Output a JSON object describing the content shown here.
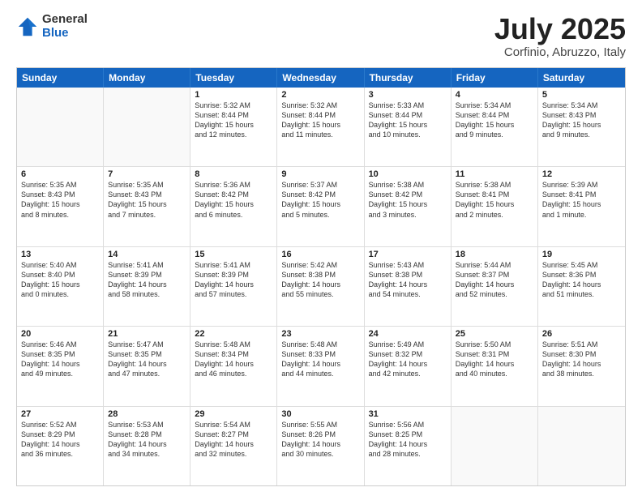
{
  "logo": {
    "general": "General",
    "blue": "Blue"
  },
  "title": "July 2025",
  "subtitle": "Corfinio, Abruzzo, Italy",
  "header_days": [
    "Sunday",
    "Monday",
    "Tuesday",
    "Wednesday",
    "Thursday",
    "Friday",
    "Saturday"
  ],
  "weeks": [
    [
      {
        "day": "",
        "lines": []
      },
      {
        "day": "",
        "lines": []
      },
      {
        "day": "1",
        "lines": [
          "Sunrise: 5:32 AM",
          "Sunset: 8:44 PM",
          "Daylight: 15 hours",
          "and 12 minutes."
        ]
      },
      {
        "day": "2",
        "lines": [
          "Sunrise: 5:32 AM",
          "Sunset: 8:44 PM",
          "Daylight: 15 hours",
          "and 11 minutes."
        ]
      },
      {
        "day": "3",
        "lines": [
          "Sunrise: 5:33 AM",
          "Sunset: 8:44 PM",
          "Daylight: 15 hours",
          "and 10 minutes."
        ]
      },
      {
        "day": "4",
        "lines": [
          "Sunrise: 5:34 AM",
          "Sunset: 8:44 PM",
          "Daylight: 15 hours",
          "and 9 minutes."
        ]
      },
      {
        "day": "5",
        "lines": [
          "Sunrise: 5:34 AM",
          "Sunset: 8:43 PM",
          "Daylight: 15 hours",
          "and 9 minutes."
        ]
      }
    ],
    [
      {
        "day": "6",
        "lines": [
          "Sunrise: 5:35 AM",
          "Sunset: 8:43 PM",
          "Daylight: 15 hours",
          "and 8 minutes."
        ]
      },
      {
        "day": "7",
        "lines": [
          "Sunrise: 5:35 AM",
          "Sunset: 8:43 PM",
          "Daylight: 15 hours",
          "and 7 minutes."
        ]
      },
      {
        "day": "8",
        "lines": [
          "Sunrise: 5:36 AM",
          "Sunset: 8:42 PM",
          "Daylight: 15 hours",
          "and 6 minutes."
        ]
      },
      {
        "day": "9",
        "lines": [
          "Sunrise: 5:37 AM",
          "Sunset: 8:42 PM",
          "Daylight: 15 hours",
          "and 5 minutes."
        ]
      },
      {
        "day": "10",
        "lines": [
          "Sunrise: 5:38 AM",
          "Sunset: 8:42 PM",
          "Daylight: 15 hours",
          "and 3 minutes."
        ]
      },
      {
        "day": "11",
        "lines": [
          "Sunrise: 5:38 AM",
          "Sunset: 8:41 PM",
          "Daylight: 15 hours",
          "and 2 minutes."
        ]
      },
      {
        "day": "12",
        "lines": [
          "Sunrise: 5:39 AM",
          "Sunset: 8:41 PM",
          "Daylight: 15 hours",
          "and 1 minute."
        ]
      }
    ],
    [
      {
        "day": "13",
        "lines": [
          "Sunrise: 5:40 AM",
          "Sunset: 8:40 PM",
          "Daylight: 15 hours",
          "and 0 minutes."
        ]
      },
      {
        "day": "14",
        "lines": [
          "Sunrise: 5:41 AM",
          "Sunset: 8:39 PM",
          "Daylight: 14 hours",
          "and 58 minutes."
        ]
      },
      {
        "day": "15",
        "lines": [
          "Sunrise: 5:41 AM",
          "Sunset: 8:39 PM",
          "Daylight: 14 hours",
          "and 57 minutes."
        ]
      },
      {
        "day": "16",
        "lines": [
          "Sunrise: 5:42 AM",
          "Sunset: 8:38 PM",
          "Daylight: 14 hours",
          "and 55 minutes."
        ]
      },
      {
        "day": "17",
        "lines": [
          "Sunrise: 5:43 AM",
          "Sunset: 8:38 PM",
          "Daylight: 14 hours",
          "and 54 minutes."
        ]
      },
      {
        "day": "18",
        "lines": [
          "Sunrise: 5:44 AM",
          "Sunset: 8:37 PM",
          "Daylight: 14 hours",
          "and 52 minutes."
        ]
      },
      {
        "day": "19",
        "lines": [
          "Sunrise: 5:45 AM",
          "Sunset: 8:36 PM",
          "Daylight: 14 hours",
          "and 51 minutes."
        ]
      }
    ],
    [
      {
        "day": "20",
        "lines": [
          "Sunrise: 5:46 AM",
          "Sunset: 8:35 PM",
          "Daylight: 14 hours",
          "and 49 minutes."
        ]
      },
      {
        "day": "21",
        "lines": [
          "Sunrise: 5:47 AM",
          "Sunset: 8:35 PM",
          "Daylight: 14 hours",
          "and 47 minutes."
        ]
      },
      {
        "day": "22",
        "lines": [
          "Sunrise: 5:48 AM",
          "Sunset: 8:34 PM",
          "Daylight: 14 hours",
          "and 46 minutes."
        ]
      },
      {
        "day": "23",
        "lines": [
          "Sunrise: 5:48 AM",
          "Sunset: 8:33 PM",
          "Daylight: 14 hours",
          "and 44 minutes."
        ]
      },
      {
        "day": "24",
        "lines": [
          "Sunrise: 5:49 AM",
          "Sunset: 8:32 PM",
          "Daylight: 14 hours",
          "and 42 minutes."
        ]
      },
      {
        "day": "25",
        "lines": [
          "Sunrise: 5:50 AM",
          "Sunset: 8:31 PM",
          "Daylight: 14 hours",
          "and 40 minutes."
        ]
      },
      {
        "day": "26",
        "lines": [
          "Sunrise: 5:51 AM",
          "Sunset: 8:30 PM",
          "Daylight: 14 hours",
          "and 38 minutes."
        ]
      }
    ],
    [
      {
        "day": "27",
        "lines": [
          "Sunrise: 5:52 AM",
          "Sunset: 8:29 PM",
          "Daylight: 14 hours",
          "and 36 minutes."
        ]
      },
      {
        "day": "28",
        "lines": [
          "Sunrise: 5:53 AM",
          "Sunset: 8:28 PM",
          "Daylight: 14 hours",
          "and 34 minutes."
        ]
      },
      {
        "day": "29",
        "lines": [
          "Sunrise: 5:54 AM",
          "Sunset: 8:27 PM",
          "Daylight: 14 hours",
          "and 32 minutes."
        ]
      },
      {
        "day": "30",
        "lines": [
          "Sunrise: 5:55 AM",
          "Sunset: 8:26 PM",
          "Daylight: 14 hours",
          "and 30 minutes."
        ]
      },
      {
        "day": "31",
        "lines": [
          "Sunrise: 5:56 AM",
          "Sunset: 8:25 PM",
          "Daylight: 14 hours",
          "and 28 minutes."
        ]
      },
      {
        "day": "",
        "lines": []
      },
      {
        "day": "",
        "lines": []
      }
    ]
  ]
}
